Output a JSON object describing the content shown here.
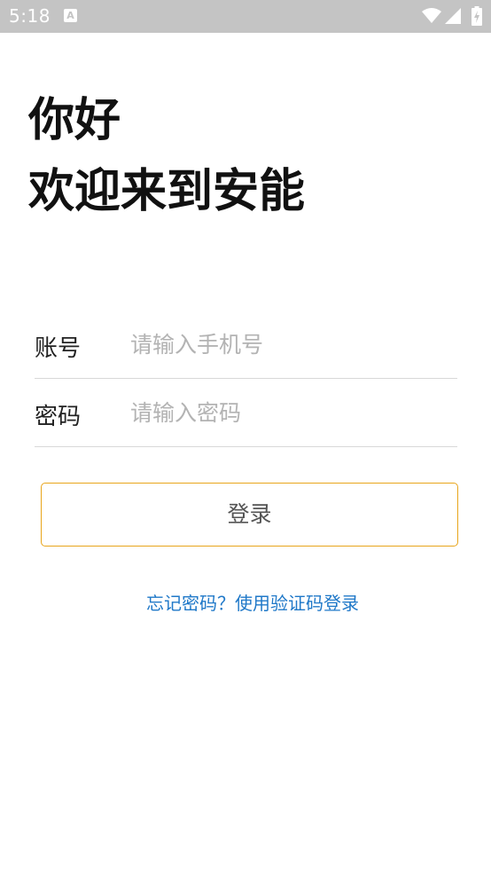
{
  "status_bar": {
    "time": "5:18",
    "notification_icon_letter": "A",
    "icons": [
      "notification-a-icon",
      "wifi-icon",
      "signal-icon",
      "battery-charging-icon"
    ]
  },
  "greeting": {
    "line1": "你好",
    "line2": "欢迎来到安能"
  },
  "form": {
    "account_label": "账号",
    "account_placeholder": "请输入手机号",
    "account_value": "",
    "password_label": "密码",
    "password_placeholder": "请输入密码",
    "password_value": ""
  },
  "login_button_label": "登录",
  "forgot_link_text": "忘记密码？使用验证码登录",
  "colors": {
    "status_bar_bg": "#c4c4c4",
    "button_border": "#e8a51b",
    "link": "#1f78c8",
    "placeholder": "#b3b3b3"
  }
}
